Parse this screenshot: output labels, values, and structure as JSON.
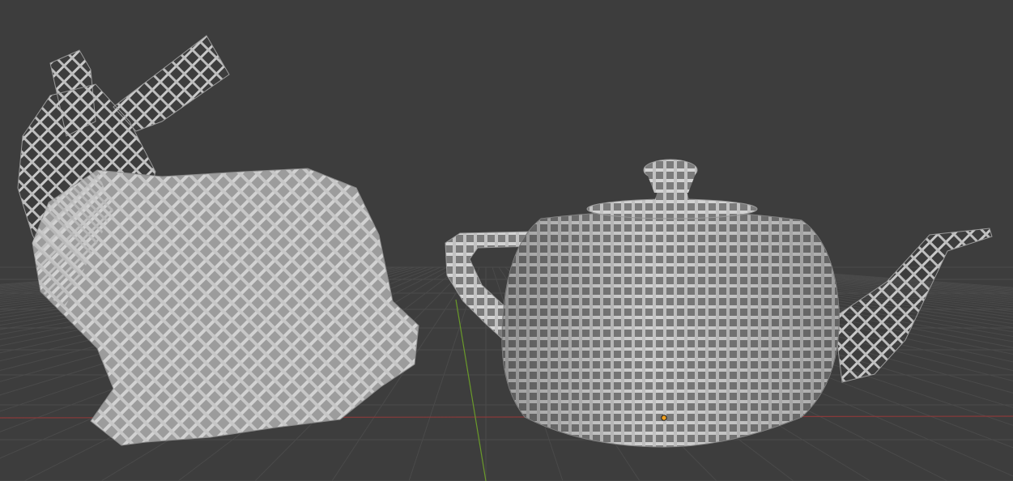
{
  "viewport": {
    "background_color": "#3d3d3d",
    "grid_color": "#4a4a4a",
    "x_axis_color": "#8a3a3a",
    "y_axis_color": "#6a9a2a",
    "origin_marker_color": "#f0a020"
  },
  "objects": [
    {
      "name": "bunny",
      "material_color": "#b9b9b9",
      "selected": false
    },
    {
      "name": "teapot",
      "material_color": "#c4c4c4",
      "selected": true
    }
  ]
}
